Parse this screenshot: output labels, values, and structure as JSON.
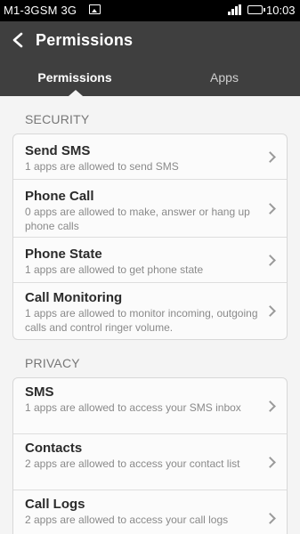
{
  "status": {
    "carrier": "M1-3GSM 3G",
    "time": "10:03"
  },
  "header": {
    "title": "Permissions"
  },
  "tabs": [
    {
      "label": "Permissions"
    },
    {
      "label": "Apps"
    }
  ],
  "sections": [
    {
      "title": "SECURITY",
      "items": [
        {
          "title": "Send SMS",
          "desc": "1 apps are allowed to send SMS"
        },
        {
          "title": "Phone Call",
          "desc": "0 apps are allowed to make, answer or hang up phone calls"
        },
        {
          "title": "Phone State",
          "desc": "1 apps are allowed to get phone state"
        },
        {
          "title": "Call Monitoring",
          "desc": "1 apps are allowed to monitor incoming, outgoing calls and control ringer volume."
        }
      ]
    },
    {
      "title": "PRIVACY",
      "items": [
        {
          "title": "SMS",
          "desc": "1 apps are allowed to access your SMS inbox"
        },
        {
          "title": "Contacts",
          "desc": "2 apps are allowed to access your contact list"
        },
        {
          "title": "Call Logs",
          "desc": "2 apps are allowed to access your call logs"
        }
      ]
    }
  ]
}
